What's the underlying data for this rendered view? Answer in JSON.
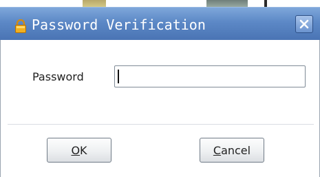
{
  "dialog": {
    "title": "Password Verification",
    "title_icon": "lock-icon",
    "close_icon": "close-icon"
  },
  "form": {
    "password_label": "Password",
    "password_value": "",
    "password_placeholder": ""
  },
  "buttons": {
    "ok": {
      "mnemonic": "O",
      "rest": "K"
    },
    "cancel": {
      "mnemonic": "C",
      "rest": "ancel"
    }
  },
  "colors": {
    "titlebar": "#5c88c6",
    "title_text": "#ffffff",
    "lock_icon": "#f0b020"
  }
}
